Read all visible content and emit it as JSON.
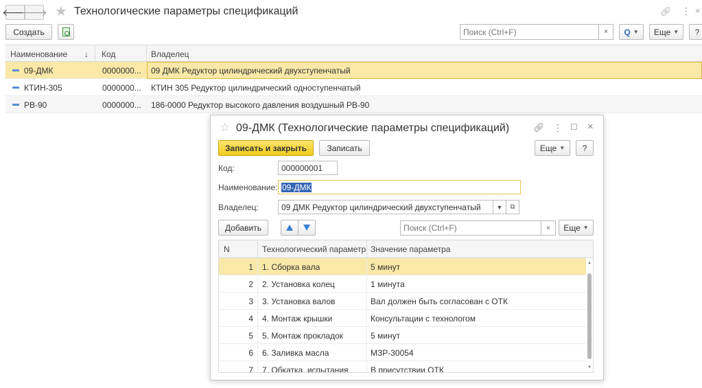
{
  "window": {
    "title": "Технологические параметры спецификаций"
  },
  "toolbar": {
    "create_label": "Создать",
    "search_placeholder": "Поиск (Ctrl+F)",
    "clear_label": "×",
    "search_button_label": "Q",
    "more_label": "Еще",
    "help_label": "?"
  },
  "list": {
    "columns": [
      "Наименование",
      "Код",
      "Владелец"
    ],
    "sort_indicator": "↓",
    "rows": [
      {
        "name": "09-ДМК",
        "code": "0000000...",
        "owner": "09 ДМК Редуктор цилиндрический двухступенчатый"
      },
      {
        "name": "КТИН-305",
        "code": "0000000...",
        "owner": "КТИН 305 Редуктор цилиндрический одноступенчатый"
      },
      {
        "name": "РВ-90",
        "code": "0000000...",
        "owner": "186-0000 Редуктор высокого давления воздушный РВ-90"
      }
    ]
  },
  "dialog": {
    "title": "09-ДМК (Технологические параметры спецификаций)",
    "save_close_label": "Записать и закрыть",
    "save_label": "Записать",
    "more_label": "Еще",
    "help_label": "?",
    "code_label": "Код:",
    "code_value": "000000001",
    "name_label": "Наименование:",
    "name_value": "09-ДМК",
    "owner_label": "Владелец:",
    "owner_value": "09 ДМК Редуктор цилиндрический двухступенчатый",
    "add_label": "Добавить",
    "search_placeholder": "Поиск (Ctrl+F)",
    "clear_label": "×",
    "table": {
      "columns": [
        "N",
        "Технологический параметр",
        "Значение параметра"
      ],
      "rows": [
        {
          "n": "1",
          "param": "1. Сборка вала",
          "value": "5 минут"
        },
        {
          "n": "2",
          "param": "2. Установка колец",
          "value": "1 минута"
        },
        {
          "n": "3",
          "param": "3. Установка валов",
          "value": "Вал должен быть согласован с ОТК"
        },
        {
          "n": "4",
          "param": "4. Монтаж крышки",
          "value": "Консультации с технологом"
        },
        {
          "n": "5",
          "param": "5. Монтаж прокладок",
          "value": "5 минут"
        },
        {
          "n": "6",
          "param": "6. Заливка масла",
          "value": "МЗР-30054"
        },
        {
          "n": "7",
          "param": "7. Обкатка, испытания",
          "value": "В присутствии ОТК"
        }
      ]
    }
  },
  "colors": {
    "selection": "#f9e8a7",
    "primary_button": "#f2cc1c",
    "accent_blue": "#3a7fd0"
  },
  "icons": [
    "back-icon",
    "forward-icon",
    "favorite-star-icon",
    "link-icon",
    "more-vertical-icon",
    "close-icon",
    "copy-icon",
    "search-icon",
    "maximize-icon",
    "move-up-icon",
    "move-down-icon",
    "open-icon"
  ]
}
